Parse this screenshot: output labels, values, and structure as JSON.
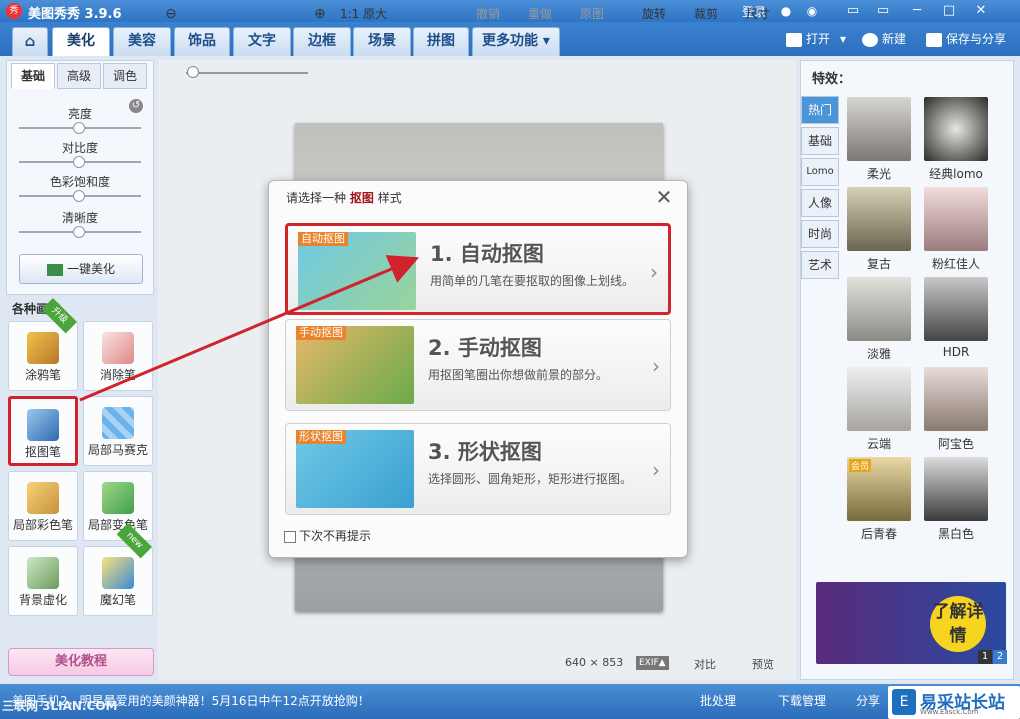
{
  "window": {
    "title": "美图秀秀 3.9.6",
    "login": "登录",
    "logo_char": "秀",
    "controls": [
      "▭",
      "─",
      "□",
      "✕"
    ]
  },
  "tabs": [
    {
      "label": "⌂"
    },
    {
      "label": "美化"
    },
    {
      "label": "美容"
    },
    {
      "label": "饰品"
    },
    {
      "label": "文字"
    },
    {
      "label": "边框"
    },
    {
      "label": "场景"
    },
    {
      "label": "拼图"
    },
    {
      "label": "更多功能 ▾"
    }
  ],
  "topright": {
    "open": "打开",
    "new": "新建",
    "save": "保存与分享",
    "dropdown": "▾"
  },
  "left": {
    "tabs": [
      "基础",
      "高级",
      "调色"
    ],
    "reset_icon": "↺",
    "sliders": [
      {
        "label": "亮度",
        "value": 0.5
      },
      {
        "label": "对比度",
        "value": 0.5
      },
      {
        "label": "色彩饱和度",
        "value": 0.5
      },
      {
        "label": "清晰度",
        "value": 0.5
      }
    ],
    "onekey": "一键美化",
    "brush_title": "各种画笔"
  },
  "tools": [
    {
      "label": "涂鸦笔",
      "badge": "升级"
    },
    {
      "label": "消除笔",
      "badge": ""
    },
    {
      "label": "抠图笔",
      "badge": ""
    },
    {
      "label": "局部马赛克",
      "badge": ""
    },
    {
      "label": "局部彩色笔",
      "badge": ""
    },
    {
      "label": "局部变色笔",
      "badge": ""
    },
    {
      "label": "背景虚化",
      "badge": ""
    },
    {
      "label": "魔幻笔",
      "badge": "new"
    }
  ],
  "tutorial": "美化教程",
  "toolbar": {
    "zoom_out": "⊖",
    "zoom_in": "⊕",
    "ratio": "1:1 原大",
    "undo": "撤销",
    "redo": "重做",
    "original": "原图",
    "rotate": "旋转",
    "crop": "裁剪",
    "size": "尺寸"
  },
  "dialog": {
    "title_prefix": "请选择一种",
    "title_key": "抠图",
    "title_suffix": "样式",
    "close": "✕",
    "dontshow": "下次不再提示",
    "options": [
      {
        "tag": "自动抠图",
        "heading": "1. 自动抠图",
        "desc": "用简单的几笔在要抠取的图像上划线。",
        "arrow": "›"
      },
      {
        "tag": "手动抠图",
        "heading": "2. 手动抠图",
        "desc": "用抠图笔圈出你想做前景的部分。",
        "arrow": "›"
      },
      {
        "tag": "形状抠图",
        "heading": "3. 形状抠图",
        "desc": "选择圆形、圆角矩形，矩形进行抠图。",
        "arrow": "›"
      }
    ]
  },
  "status": {
    "dims": "640 × 853",
    "exif": "EXIF▲",
    "compare": "对比",
    "preview": "预览"
  },
  "right": {
    "title": "特效：",
    "tabs": [
      "热门",
      "基础",
      "Lomo",
      "人像",
      "时尚",
      "艺术"
    ],
    "effects": [
      {
        "label": "柔光"
      },
      {
        "label": "经典lomo"
      },
      {
        "label": "复古"
      },
      {
        "label": "粉红佳人"
      },
      {
        "label": "淡雅"
      },
      {
        "label": "HDR"
      },
      {
        "label": "云端"
      },
      {
        "label": "阿宝色"
      },
      {
        "label": "后青春",
        "badge": "会员"
      },
      {
        "label": "黑白色"
      }
    ],
    "banner": "了解详情",
    "pager": [
      "1",
      "2"
    ]
  },
  "bottom": {
    "news": "美图手机2，明星最爱用的美颜神器！5月16日中午12点开放抢购！",
    "batch": "批处理",
    "download": "下载管理",
    "share": "分享",
    "watermark": "三联网 3LIAN.COM",
    "site": "易采站长站",
    "site_sub": "Www.Easck.Com"
  },
  "colors": {
    "accent": "#2f74c4",
    "highlight": "#d0232c",
    "title_key": "#a1141b"
  }
}
